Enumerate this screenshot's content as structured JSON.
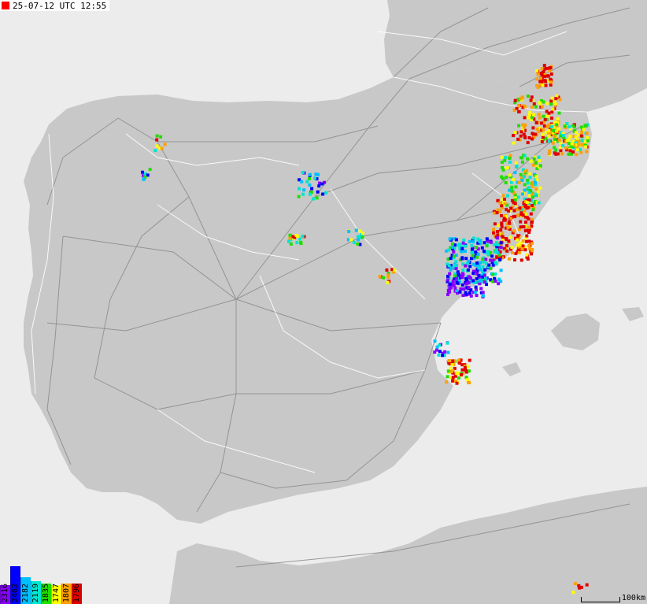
{
  "header": {
    "timestamp": "25-07-12 UTC 12:55",
    "marker_color": "#ff0000"
  },
  "legend": {
    "items": [
      {
        "label": "2316",
        "color": "#8a00ff",
        "height_pct": 0.5
      },
      {
        "label": "2462",
        "color": "#0000ff",
        "height_pct": 1.0
      },
      {
        "label": "2182",
        "color": "#00bfff",
        "height_pct": 0.7
      },
      {
        "label": "2119",
        "color": "#00e5d0",
        "height_pct": 0.6
      },
      {
        "label": "1835",
        "color": "#22dd00",
        "height_pct": 0.55
      },
      {
        "label": "1747",
        "color": "#ffff00",
        "height_pct": 0.5
      },
      {
        "label": "1807",
        "color": "#ffa000",
        "height_pct": 0.55
      },
      {
        "label": "1796",
        "color": "#e00000",
        "height_pct": 0.55
      }
    ]
  },
  "scale": {
    "label": "100km"
  },
  "colors": {
    "sea": "#ececec",
    "land": "#c8c8c8",
    "roads": "#8a8a8a",
    "borders": "#ffffff"
  }
}
